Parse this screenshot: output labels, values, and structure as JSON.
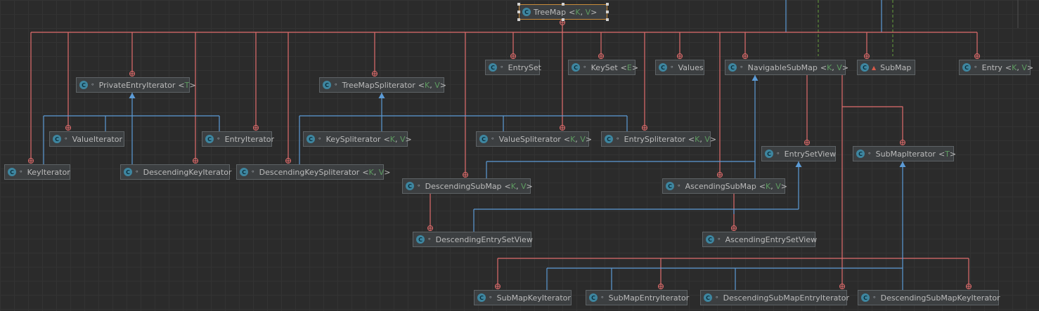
{
  "diagram": {
    "nodes": [
      {
        "id": "treemap",
        "kind": "C",
        "vis": "",
        "name": "TreeMap",
        "params": [
          "K",
          "V"
        ],
        "selected": true
      },
      {
        "id": "entryset",
        "kind": "C",
        "vis": "∘",
        "name": "EntrySet",
        "params": []
      },
      {
        "id": "keyset",
        "kind": "C",
        "vis": "∘",
        "name": "KeySet",
        "params": [
          "E"
        ]
      },
      {
        "id": "values",
        "kind": "C",
        "vis": "∘",
        "name": "Values",
        "params": []
      },
      {
        "id": "navsubmap",
        "kind": "C",
        "vis": "∘",
        "name": "NavigableSubMap",
        "params": [
          "K",
          "V"
        ]
      },
      {
        "id": "submap",
        "kind": "C",
        "vis": "",
        "name": "SubMap",
        "params": [],
        "locked": true
      },
      {
        "id": "entry",
        "kind": "C",
        "vis": "∘",
        "name": "Entry",
        "params": [
          "K",
          "V"
        ]
      },
      {
        "id": "privateentryiterator",
        "kind": "C",
        "vis": "∘",
        "name": "PrivateEntryIterator",
        "params": [
          "T"
        ]
      },
      {
        "id": "treemapspliterator",
        "kind": "C",
        "vis": "∘",
        "name": "TreeMapSpliterator",
        "params": [
          "K",
          "V"
        ]
      },
      {
        "id": "valueiterator",
        "kind": "C",
        "vis": "∘",
        "name": "ValueIterator",
        "params": []
      },
      {
        "id": "entryiterator",
        "kind": "C",
        "vis": "∘",
        "name": "EntryIterator",
        "params": []
      },
      {
        "id": "keyspliterator",
        "kind": "C",
        "vis": "∘",
        "name": "KeySpliterator",
        "params": [
          "K",
          "V"
        ]
      },
      {
        "id": "valuespliterator",
        "kind": "C",
        "vis": "∘",
        "name": "ValueSpliterator",
        "params": [
          "K",
          "V"
        ]
      },
      {
        "id": "entryspliterator",
        "kind": "C",
        "vis": "∘",
        "name": "EntrySpliterator",
        "params": [
          "K",
          "V"
        ]
      },
      {
        "id": "entrysetview",
        "kind": "C",
        "vis": "∘",
        "name": "EntrySetView",
        "params": []
      },
      {
        "id": "submapiterator",
        "kind": "C",
        "vis": "∘",
        "name": "SubMapIterator",
        "params": [
          "T"
        ]
      },
      {
        "id": "keyiterator",
        "kind": "C",
        "vis": "∘",
        "name": "KeyIterator",
        "params": []
      },
      {
        "id": "descendingkeyiterator",
        "kind": "C",
        "vis": "∘",
        "name": "DescendingKeyIterator",
        "params": []
      },
      {
        "id": "descendingkeyspliterator",
        "kind": "C",
        "vis": "∘",
        "name": "DescendingKeySpliterator",
        "params": [
          "K",
          "V"
        ]
      },
      {
        "id": "descendingsubmap",
        "kind": "C",
        "vis": "∘",
        "name": "DescendingSubMap",
        "params": [
          "K",
          "V"
        ]
      },
      {
        "id": "ascendingsubmap",
        "kind": "C",
        "vis": "∘",
        "name": "AscendingSubMap",
        "params": [
          "K",
          "V"
        ]
      },
      {
        "id": "descendingentrysetview",
        "kind": "C",
        "vis": "∘",
        "name": "DescendingEntrySetView",
        "params": []
      },
      {
        "id": "ascendingentrysetview",
        "kind": "C",
        "vis": "∘",
        "name": "AscendingEntrySetView",
        "params": []
      },
      {
        "id": "submapkeyiterator",
        "kind": "C",
        "vis": "∘",
        "name": "SubMapKeyIterator",
        "params": []
      },
      {
        "id": "submapentryiterator",
        "kind": "C",
        "vis": "∘",
        "name": "SubMapEntryIterator",
        "params": []
      },
      {
        "id": "descendingsubmapentryiterator",
        "kind": "C",
        "vis": "∘",
        "name": "DescendingSubMapEntryIterator",
        "params": []
      },
      {
        "id": "descendingsubmapkeyiterator",
        "kind": "C",
        "vis": "∘",
        "name": "DescendingSubMapKeyIterator",
        "params": []
      }
    ],
    "colors": {
      "background": "#2b2b2b",
      "grid": "#333333",
      "node_fill": "#3c3f41",
      "node_border": "#5e6366",
      "node_text": "#bbbbbb",
      "type_param": "#5e9c61",
      "selected_border": "#c98b3a",
      "inner_class_edge": "#e06c6c",
      "inheritance_edge": "#5c9bd6",
      "implementation_edge": "#5b8c3a",
      "class_icon": "#3e86a0"
    }
  }
}
